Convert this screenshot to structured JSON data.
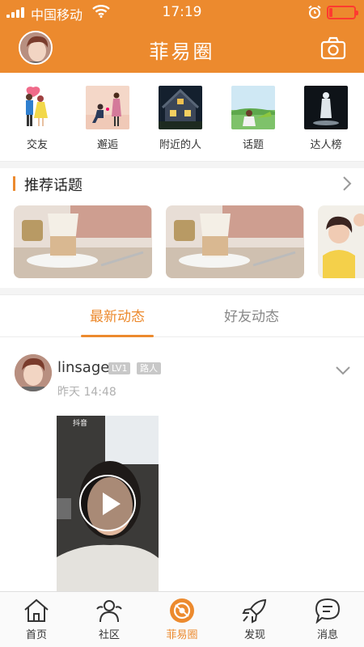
{
  "status_bar": {
    "carrier": "中国移动",
    "time": "17:19"
  },
  "header": {
    "title": "菲易圈",
    "camera_icon": "camera-icon"
  },
  "categories": [
    {
      "label": "交友",
      "icon": "couple-thumb"
    },
    {
      "label": "邂逅",
      "icon": "proposal-thumb"
    },
    {
      "label": "附近的人",
      "icon": "house-night-thumb"
    },
    {
      "label": "话题",
      "icon": "landscape-thumb"
    },
    {
      "label": "达人榜",
      "icon": "statue-thumb"
    }
  ],
  "topics": {
    "title": "推荐话题",
    "more_icon": "chevron-right-icon"
  },
  "feed_tabs": [
    {
      "label": "最新动态",
      "active": true
    },
    {
      "label": "好友动态",
      "active": false
    }
  ],
  "post": {
    "username": "linsage",
    "level_badge": "LV1",
    "role_badge": "路人",
    "time": "昨天 14:48",
    "video_watermark": "抖音"
  },
  "tabbar": [
    {
      "label": "首页",
      "icon": "home-icon",
      "active": false
    },
    {
      "label": "社区",
      "icon": "community-icon",
      "active": false
    },
    {
      "label": "菲易圈",
      "icon": "circle-icon",
      "active": true
    },
    {
      "label": "发现",
      "icon": "rocket-icon",
      "active": false
    },
    {
      "label": "消息",
      "icon": "message-icon",
      "active": false
    }
  ],
  "colors": {
    "brand": "#ec8a2e",
    "battery": "#ff3b30"
  }
}
